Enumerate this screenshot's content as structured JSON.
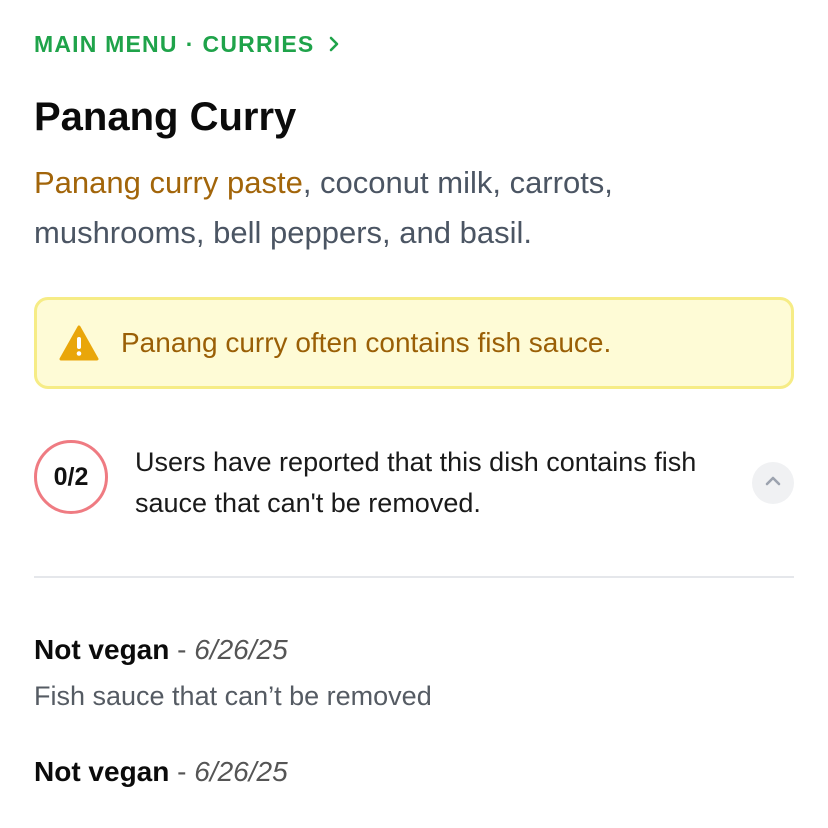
{
  "breadcrumb": {
    "parent": "MAIN MENU",
    "separator": "·",
    "current": "CURRIES"
  },
  "dish": {
    "title": "Panang Curry",
    "highlight_ingredient": "Panang curry paste",
    "ingredients_rest": ", coconut milk, carrots, mushrooms, bell peppers, and basil."
  },
  "warning": {
    "icon": "warning-triangle-icon",
    "text": "Panang curry often contains fish sauce."
  },
  "report": {
    "count": "0/2",
    "text": "Users have reported that this dish contains fish sauce that can't be removed.",
    "toggle_icon": "chevron-up-icon"
  },
  "reports": [
    {
      "label": "Not vegan",
      "separator": "-",
      "date": "6/26/25",
      "note": "Fish sauce that can’t be removed"
    },
    {
      "label": "Not vegan",
      "separator": "-",
      "date": "6/26/25",
      "note": ""
    }
  ],
  "colors": {
    "breadcrumb": "#1fa34a",
    "highlight": "#a2650a",
    "warning_bg": "#fefbd6",
    "warning_border": "#f6ec86",
    "warning_text": "#9a5f06",
    "badge_ring": "#ef7b82"
  }
}
